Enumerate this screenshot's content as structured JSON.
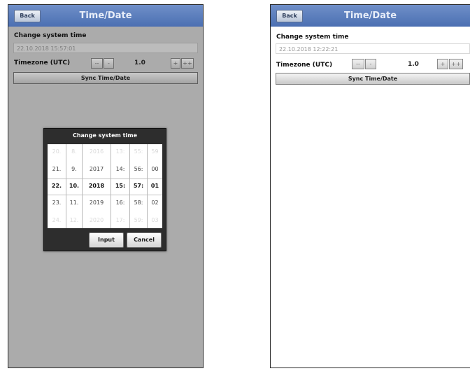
{
  "left": {
    "title": "Time/Date",
    "back_label": "Back",
    "change_label": "Change system time",
    "datetime_value": "22.10.2018 15:57:01",
    "timezone_label": "Timezone (UTC)",
    "tz_buttons": [
      "--",
      "-",
      "+",
      "++"
    ],
    "tz_value": "1.0",
    "sync_label": "Sync Time/Date",
    "dialog": {
      "title": "Change system time",
      "columns": [
        [
          "20.",
          "21.",
          "22.",
          "23.",
          "24."
        ],
        [
          "8.",
          "9.",
          "10.",
          "11.",
          "12."
        ],
        [
          "2016",
          "2017",
          "2018",
          "2019",
          "2020"
        ],
        [
          "13:",
          "14:",
          "15:",
          "16:",
          "17:"
        ],
        [
          "55:",
          "56:",
          "57:",
          "58:",
          "59:"
        ],
        [
          "59",
          "00",
          "01",
          "02",
          "03"
        ]
      ],
      "input_label": "Input",
      "cancel_label": "Cancel"
    }
  },
  "right": {
    "title": "Time/Date",
    "back_label": "Back",
    "change_label": "Change system time",
    "datetime_value": "22.10.2018 12:22:21",
    "timezone_label": "Timezone (UTC)",
    "tz_buttons": [
      "--",
      "-",
      "+",
      "++"
    ],
    "tz_value": "1.0",
    "sync_label": "Sync Time/Date"
  }
}
